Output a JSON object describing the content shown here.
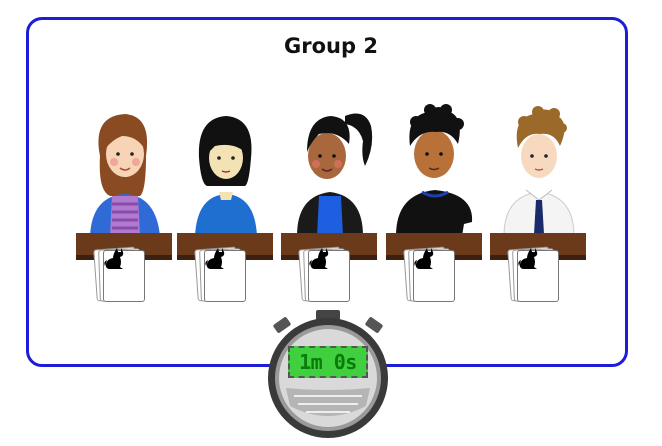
{
  "group_title": "Group 2",
  "timer": {
    "text": "1m 0s"
  },
  "colors": {
    "panel_border": "#1c1cd9",
    "desk": "#6b3a1a",
    "timer_display": "#3fcf3f"
  },
  "students": [
    {
      "id": "student-1",
      "card_icon": "cat-icon"
    },
    {
      "id": "student-2",
      "card_icon": "cat-icon"
    },
    {
      "id": "student-3",
      "card_icon": "cat-icon"
    },
    {
      "id": "student-4",
      "card_icon": "cat-icon"
    },
    {
      "id": "student-5",
      "card_icon": "cat-icon"
    }
  ]
}
